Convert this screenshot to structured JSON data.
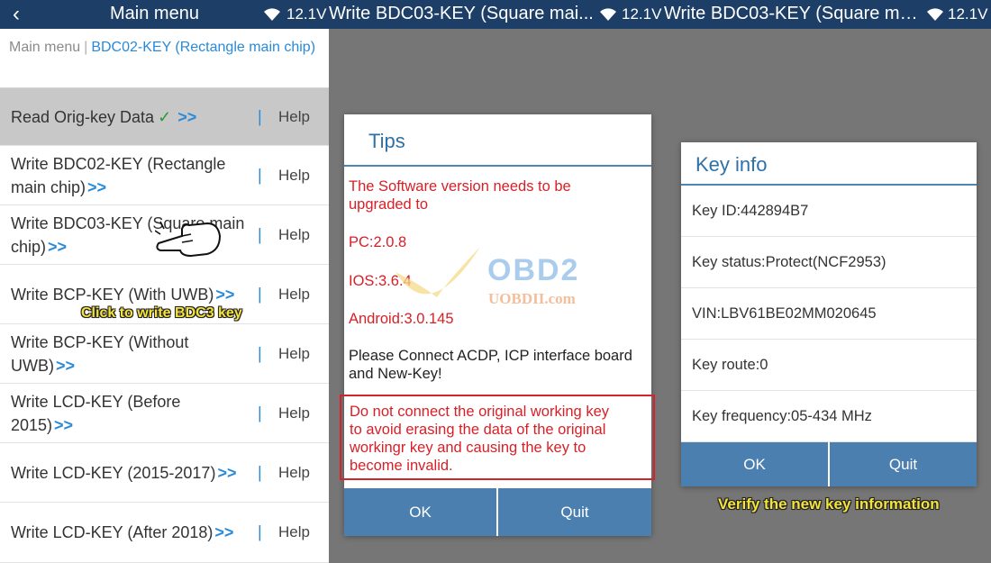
{
  "panel1": {
    "statusbar": {
      "title": "Main menu",
      "voltage": "12.1V"
    },
    "breadcrumb": {
      "root": "Main menu",
      "separator": "|",
      "current": "BDC02-KEY (Rectangle main chip)"
    },
    "items": [
      {
        "label": "Read Orig-key Data",
        "check": "✓",
        "arrow": ">>",
        "help": "Help",
        "active": true
      },
      {
        "label": "Write BDC02-KEY (Rectangle main chip)",
        "arrow": ">>",
        "help": "Help"
      },
      {
        "label": "Write BDC03-KEY (Square main chip)",
        "arrow": ">>",
        "help": "Help"
      },
      {
        "label": "Write BCP-KEY (With UWB)",
        "arrow": ">>",
        "help": "Help"
      },
      {
        "label": "Write BCP-KEY (Without UWB)",
        "arrow": ">>",
        "help": "Help"
      },
      {
        "label": "Write LCD-KEY (Before 2015)",
        "arrow": ">>",
        "help": "Help"
      },
      {
        "label": "Write LCD-KEY (2015-2017)",
        "arrow": ">>",
        "help": "Help"
      },
      {
        "label": "Write LCD-KEY (After 2018)",
        "arrow": ">>",
        "help": "Help"
      }
    ],
    "pipe": "|",
    "callout": "Click to write BDC3 key"
  },
  "panel2": {
    "statusbar": {
      "title": "Write BDC03-KEY (Square mai...",
      "voltage": "12.1V"
    },
    "dialog": {
      "title": "Tips",
      "upgrade_line1": "The Software version needs to be",
      "upgrade_line2": "upgraded to",
      "pc": "PC:2.0.8",
      "ios": "IOS:3.6.4",
      "android": "Android:3.0.145",
      "connect_line1": "Please Connect ACDP, ICP interface board",
      "connect_line2": "and New-Key!",
      "warning_line1": "Do not connect the original working key",
      "warning_line2": "to avoid erasing the data of the original",
      "warning_line3": "workingr key and causing the key to",
      "warning_line4": "become invalid.",
      "ok": "OK",
      "quit": "Quit"
    }
  },
  "panel3": {
    "statusbar": {
      "title": "Write BDC03-KEY (Square mai...",
      "voltage": "12.1V"
    },
    "dialog": {
      "title": "Key info",
      "rows": [
        "Key ID:442894B7",
        "Key status:Protect(NCF2953)",
        "VIN:LBV61BE02MM020645",
        "Key route:0",
        "Key frequency:05-434 MHz"
      ],
      "ok": "OK",
      "quit": "Quit"
    },
    "callout": "Verify the new key information"
  },
  "watermark": {
    "brand": "OBD2",
    "site": "UOBDII.com"
  },
  "colors": {
    "statusbar": "#1d3e66",
    "accent_blue": "#2a8ad8",
    "button_blue": "#4b7fb0",
    "warning_red": "#d81f26",
    "callout_yellow": "#f3e33a"
  }
}
